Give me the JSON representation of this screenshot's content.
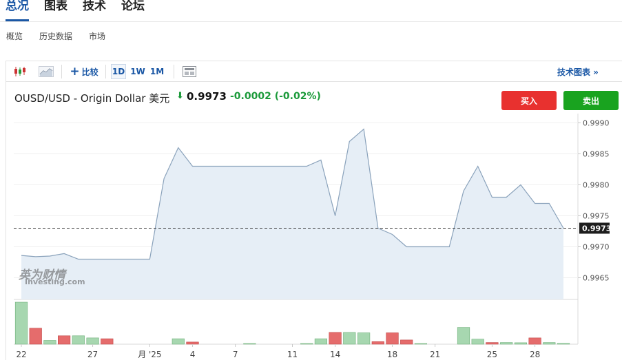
{
  "top_tabs": [
    {
      "label": "总况",
      "active": true
    },
    {
      "label": "图表",
      "active": false
    },
    {
      "label": "技术",
      "active": false
    },
    {
      "label": "论坛",
      "active": false
    }
  ],
  "sub_tabs": [
    "概览",
    "历史数据",
    "市场"
  ],
  "toolbar": {
    "compare_label": "比较",
    "periods": [
      "1D",
      "1W",
      "1M"
    ],
    "active_period": "1D",
    "tech_chart_label": "技术图表 »"
  },
  "quote": {
    "pair_name": "OUSD/USD - Origin Dollar 美元",
    "direction": "down",
    "price": "0.9973",
    "change": "-0.0002 (-0.02%)",
    "colors": {
      "up": "#1b9a3a",
      "buy": "#e8312f",
      "sell": "#19a31f"
    }
  },
  "actions": {
    "buy_label": "买入",
    "sell_label": "卖出"
  },
  "watermark": {
    "cn": "英为财情",
    "en": "Investing.com"
  },
  "chart_data": {
    "type": "area",
    "ylim": [
      0.99615,
      0.99915
    ],
    "y_ticks": [
      "0.9990",
      "0.9985",
      "0.9980",
      "0.9975",
      "0.9970",
      "0.9965"
    ],
    "y_tick_values": [
      0.999,
      0.9985,
      0.998,
      0.9975,
      0.997,
      0.9965
    ],
    "x_ticks": [
      "22",
      "27",
      "月 '25",
      "4",
      "7",
      "11",
      "14",
      "18",
      "21",
      "25",
      "28"
    ],
    "current_price_label": "0.9973",
    "current_price": 0.9973,
    "series": [
      {
        "values": [
          0.99686,
          0.99684,
          0.99685,
          0.99689,
          0.9968,
          0.9968,
          0.9968,
          0.9968,
          0.9968,
          0.9968,
          0.9981,
          0.9986,
          0.9983,
          0.9983,
          0.9983,
          0.9983,
          0.9983,
          0.9983,
          0.9983,
          0.9983,
          0.9983,
          0.9984,
          0.9975,
          0.9987,
          0.9989,
          0.9973,
          0.9972,
          0.997,
          0.997,
          0.997,
          0.997,
          0.9979,
          0.9983,
          0.9978,
          0.9978,
          0.998,
          0.9977,
          0.9977,
          0.9973
        ]
      }
    ],
    "volume": {
      "values": [
        10,
        3.8,
        0.9,
        2.0,
        2.0,
        1.5,
        1.3,
        0,
        0,
        0,
        0,
        1.3,
        0.5,
        0,
        0,
        0,
        0.1,
        0,
        0,
        0,
        0.05,
        1.3,
        2.8,
        2.8,
        2.7,
        0.6,
        2.7,
        1.0,
        0.05,
        0,
        0,
        4.0,
        1.2,
        0.4,
        0.4,
        0.35,
        1.5,
        0.4,
        0.2
      ],
      "up": [
        true,
        false,
        true,
        false,
        true,
        true,
        false,
        true,
        true,
        true,
        true,
        true,
        false,
        true,
        true,
        true,
        true,
        true,
        true,
        true,
        true,
        true,
        false,
        true,
        true,
        false,
        false,
        false,
        true,
        true,
        true,
        true,
        true,
        false,
        true,
        true,
        false,
        true,
        true
      ]
    }
  }
}
